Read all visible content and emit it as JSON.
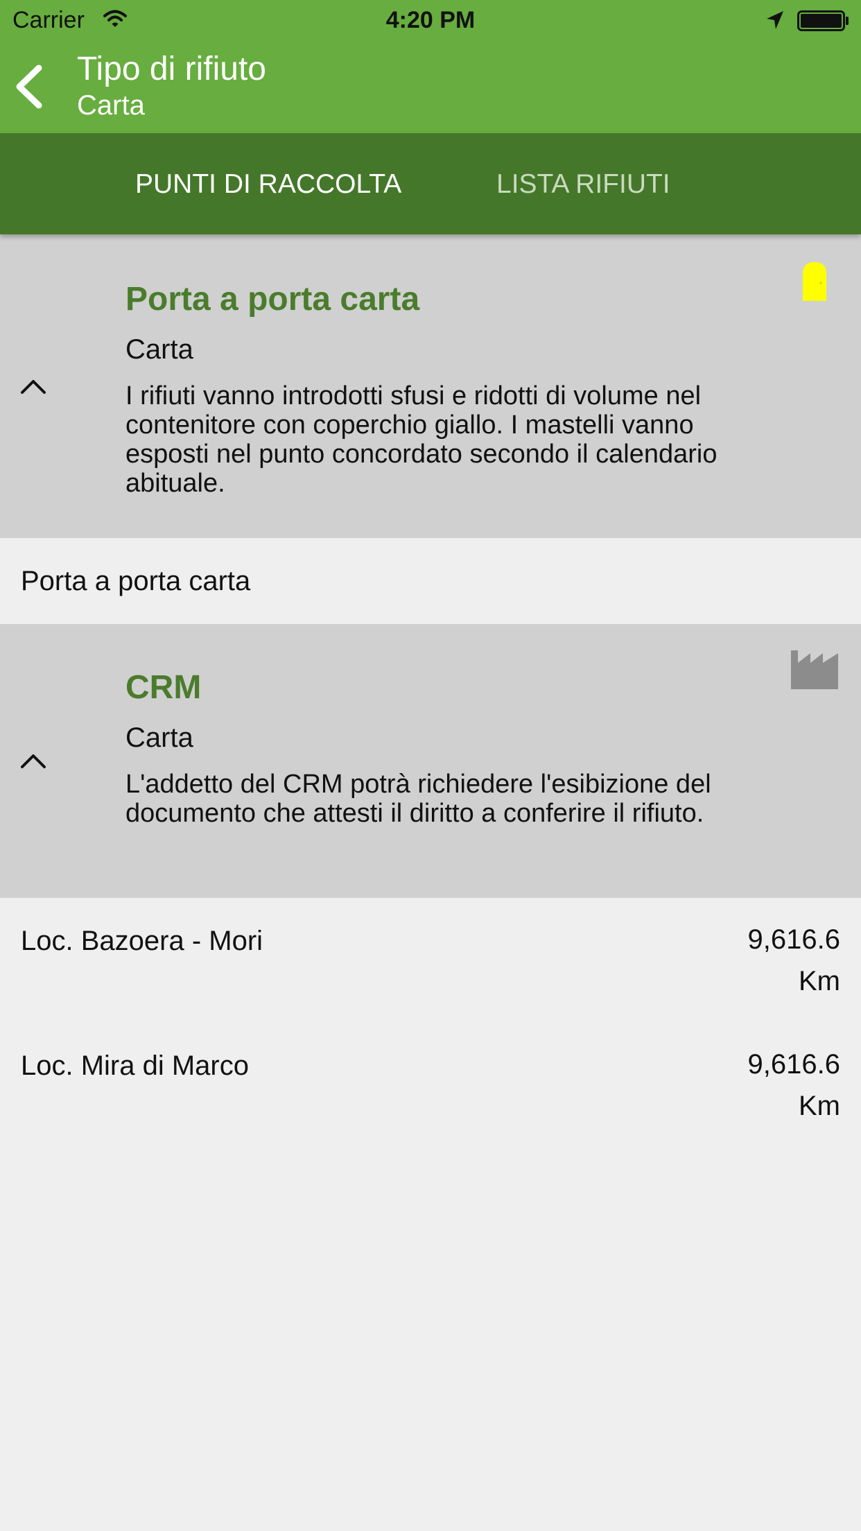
{
  "status_bar": {
    "carrier": "Carrier",
    "time": "4:20 PM"
  },
  "nav": {
    "title": "Tipo di rifiuto",
    "subtitle": "Carta"
  },
  "tabs": [
    {
      "label": "PUNTI DI RACCOLTA",
      "active": true
    },
    {
      "label": "LISTA RIFIUTI",
      "active": false
    }
  ],
  "sections": [
    {
      "title": "Porta a porta carta",
      "subtitle": "Carta",
      "description": "I rifiuti vanno introdotti sfusi e ridotti di volume nel contenitore con coperchio giallo. I mastelli vanno esposti nel punto concordato secondo il calendario abituale.",
      "icon": "door-icon",
      "icon_color": "#ffff00",
      "items": [
        {
          "label": "Porta a porta carta",
          "distance": ""
        }
      ]
    },
    {
      "title": "CRM",
      "subtitle": "Carta",
      "description": "L'addetto del CRM potrà richiedere l'esibizione del documento che attesti il diritto a conferire il rifiuto.",
      "icon": "factory-icon",
      "icon_color": "#8c8c8c",
      "items": [
        {
          "label": "Loc. Bazoera - Mori",
          "distance": "9,616.6 Km"
        },
        {
          "label": "Loc. Mira di Marco",
          "distance": "9,616.6 Km"
        }
      ]
    }
  ],
  "colors": {
    "header_green": "#67ad3f",
    "tab_green": "#45772a",
    "title_green": "#4a7c2c"
  }
}
